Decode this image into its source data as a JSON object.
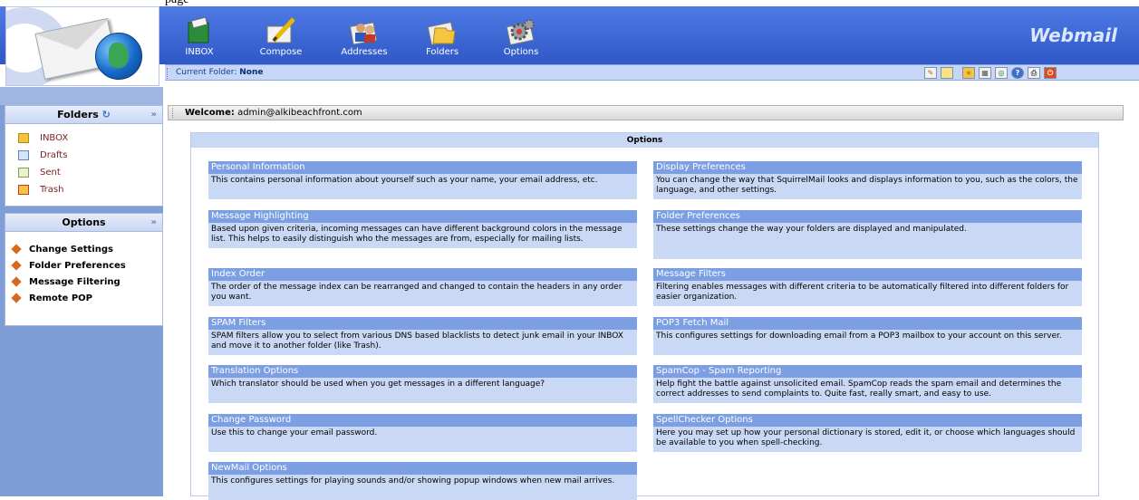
{
  "caption": "page",
  "app_title": "Webmail",
  "toolbar": [
    {
      "label": "INBOX",
      "icon": "inbox-icon"
    },
    {
      "label": "Compose",
      "icon": "compose-icon"
    },
    {
      "label": "Addresses",
      "icon": "addresses-icon"
    },
    {
      "label": "Folders",
      "icon": "folders-icon"
    },
    {
      "label": "Options",
      "icon": "options-icon"
    }
  ],
  "current_folder": {
    "label": "Current Folder:",
    "value": "None"
  },
  "welcome": {
    "label": "Welcome:",
    "value": "admin@alkibeachfront.com"
  },
  "sidebar": {
    "folders_title": "Folders",
    "folders": [
      {
        "label": "INBOX",
        "icon": "inbox-folder-icon"
      },
      {
        "label": "Drafts",
        "icon": "drafts-folder-icon"
      },
      {
        "label": "Sent",
        "icon": "sent-folder-icon"
      },
      {
        "label": "Trash",
        "icon": "trash-folder-icon"
      }
    ],
    "options_title": "Options",
    "options": [
      {
        "label": "Change Settings"
      },
      {
        "label": "Folder Preferences"
      },
      {
        "label": "Message Filtering"
      },
      {
        "label": "Remote POP"
      }
    ]
  },
  "options_panel": {
    "title": "Options",
    "left": [
      {
        "title": "Personal Information",
        "desc": "This contains personal information about yourself such as your name, your email address, etc."
      },
      {
        "title": "Message Highlighting",
        "desc": "Based upon given criteria, incoming messages can have different background colors in the message list. This helps to easily distinguish who the messages are from, especially for mailing lists."
      },
      {
        "title": "Index Order",
        "desc": "The order of the message index can be rearranged and changed to contain the headers in any order you want."
      },
      {
        "title": "SPAM Filters",
        "desc": "SPAM filters allow you to select from various DNS based blacklists to detect junk email in your INBOX and move it to another folder (like Trash)."
      },
      {
        "title": "Translation Options",
        "desc": "Which translator should be used when you get messages in a different language?"
      },
      {
        "title": "Change Password",
        "desc": "Use this to change your email password."
      },
      {
        "title": "NewMail Options",
        "desc": "This configures settings for playing sounds and/or showing popup windows when new mail arrives."
      }
    ],
    "right": [
      {
        "title": "Display Preferences",
        "desc": "You can change the way that SquirrelMail looks and displays information to you, such as the colors, the language, and other settings."
      },
      {
        "title": "Folder Preferences",
        "desc": "These settings change the way your folders are displayed and manipulated."
      },
      {
        "title": "Message Filters",
        "desc": "Filtering enables messages with different criteria to be automatically filtered into different folders for easier organization."
      },
      {
        "title": "POP3 Fetch Mail",
        "desc": "This configures settings for downloading email from a POP3 mailbox to your account on this server."
      },
      {
        "title": "SpamCop - Spam Reporting",
        "desc": "Help fight the battle against unsolicited email. SpamCop reads the spam email and determines the correct addresses to send complaints to. Quite fast, really smart, and easy to use."
      },
      {
        "title": "SpellChecker Options",
        "desc": "Here you may set up how your personal dictionary is stored, edit it, or choose which languages should be available to you when spell-checking."
      }
    ]
  },
  "top_icons": [
    "notes-icon",
    "bookmark-icon",
    "folder-new-icon",
    "calendar-icon",
    "search-icon",
    "help-icon",
    "print-icon",
    "logout-icon"
  ],
  "colors": {
    "header_blue": "#3f6ad8",
    "card_title": "#7b9fe2",
    "card_body": "#c9d9f5",
    "sidebar": "#7f9ed6"
  }
}
